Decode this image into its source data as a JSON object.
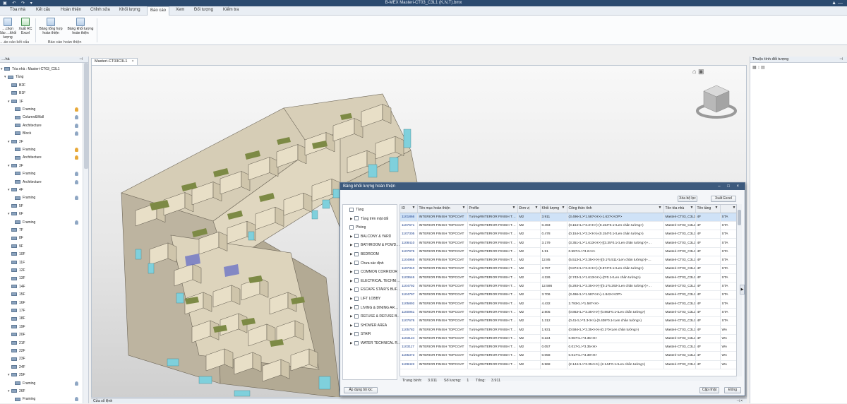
{
  "window": {
    "title": "B-MEX Masteri-CT03_C3L1 (K,N,T).bmx",
    "controls": "▲ —"
  },
  "ribbon": {
    "tabs": [
      "Tòa nhà",
      "Kết cấu",
      "Hoàn thiện",
      "Chỉnh sửa",
      "Khối lượng",
      "Báo cáo",
      "Xem",
      "Đối tượng",
      "Kiểm tra"
    ],
    "active_tab": "Báo cáo",
    "buttons": [
      {
        "label": "…chọn Báo …khối lượng",
        "icon": "report-grid-icon"
      },
      {
        "label": "Xuất RC Excel",
        "icon": "excel-export-icon"
      },
      {
        "label": "Bảng tổng hợp hoàn thiện",
        "icon": "summary-table-icon"
      },
      {
        "label": "Bảng khối lượng hoàn thiện",
        "icon": "quantity-table-icon"
      }
    ],
    "groups": [
      "…áo cáo kết cấu",
      "Báo cáo hoàn thiện"
    ]
  },
  "left_panel": {
    "title": "…hà",
    "pin": "⊣",
    "tree": [
      {
        "label": "Tòa nhà : Masteri-CT03_C3L1",
        "level": 0,
        "expander": "▾"
      },
      {
        "label": "Tầng",
        "level": 1,
        "expander": "▾"
      },
      {
        "label": "B2F",
        "level": 2,
        "expander": ""
      },
      {
        "label": "B1F",
        "level": 2,
        "expander": ""
      },
      {
        "label": "1F",
        "level": 2,
        "expander": "▾"
      },
      {
        "label": "Framing",
        "level": 3,
        "bulb": "on"
      },
      {
        "label": "Column&Wall",
        "level": 3,
        "bulb": "off"
      },
      {
        "label": "Architecture",
        "level": 3,
        "bulb": "off"
      },
      {
        "label": "Block",
        "level": 3,
        "bulb": "off"
      },
      {
        "label": "2F",
        "level": 2,
        "expander": "▾"
      },
      {
        "label": "Framing",
        "level": 3,
        "bulb": "on"
      },
      {
        "label": "Architecture",
        "level": 3,
        "bulb": "on"
      },
      {
        "label": "3F",
        "level": 2,
        "expander": "▾"
      },
      {
        "label": "Framing",
        "level": 3,
        "bulb": "off"
      },
      {
        "label": "Architecture",
        "level": 3,
        "bulb": "off"
      },
      {
        "label": "4F",
        "level": 2,
        "expander": "▾"
      },
      {
        "label": "Framing",
        "level": 3,
        "bulb": "off"
      },
      {
        "label": "5F",
        "level": 2,
        "expander": ""
      },
      {
        "label": "6F",
        "level": 2,
        "expander": "▾"
      },
      {
        "label": "Framing",
        "level": 3,
        "bulb": "off"
      },
      {
        "label": "7F",
        "level": 2,
        "expander": ""
      },
      {
        "label": "8F",
        "level": 2,
        "expander": ""
      },
      {
        "label": "9F",
        "level": 2,
        "expander": ""
      },
      {
        "label": "10F",
        "level": 2,
        "expander": ""
      },
      {
        "label": "11F",
        "level": 2,
        "expander": ""
      },
      {
        "label": "12F",
        "level": 2,
        "expander": ""
      },
      {
        "label": "13F",
        "level": 2,
        "expander": ""
      },
      {
        "label": "14F",
        "level": 2,
        "expander": ""
      },
      {
        "label": "15F",
        "level": 2,
        "expander": ""
      },
      {
        "label": "16F",
        "level": 2,
        "expander": ""
      },
      {
        "label": "17F",
        "level": 2,
        "expander": ""
      },
      {
        "label": "18F",
        "level": 2,
        "expander": ""
      },
      {
        "label": "19F",
        "level": 2,
        "expander": ""
      },
      {
        "label": "20F",
        "level": 2,
        "expander": ""
      },
      {
        "label": "21F",
        "level": 2,
        "expander": ""
      },
      {
        "label": "22F",
        "level": 2,
        "expander": ""
      },
      {
        "label": "23F",
        "level": 2,
        "expander": ""
      },
      {
        "label": "24F",
        "level": 2,
        "expander": ""
      },
      {
        "label": "25F",
        "level": 2,
        "expander": "▾"
      },
      {
        "label": "Framing",
        "level": 3,
        "bulb": "off"
      },
      {
        "label": "26F",
        "level": 2,
        "expander": "▾"
      },
      {
        "label": "Framing",
        "level": 3,
        "bulb": "off"
      }
    ]
  },
  "document_tab": {
    "label": "Masteri-CT03C3L1",
    "close": "×"
  },
  "right_panel": {
    "title": "Thuộc tính đối tượng",
    "pin": "⊣"
  },
  "bottom_panel": {
    "title": "Cửa sổ lệnh",
    "pin": "⊣ ×"
  },
  "dialog": {
    "title": "Bảng khối lượng hoàn thiện",
    "window_controls": "– □ ×",
    "clear_filter": "Xóa bộ lọc",
    "export_excel": "Xuất Excel",
    "apply_filter": "Áp dụng bộ lọc",
    "update": "Cập nhật",
    "close": "Đóng",
    "filter_tree": [
      {
        "label": "Tầng",
        "arrow": "",
        "indent": 0
      },
      {
        "label": "Tầng trên mặt đất",
        "arrow": "▶",
        "indent": 1
      },
      {
        "label": "Phòng",
        "arrow": "",
        "indent": 0
      },
      {
        "label": "BALCONY & YARD",
        "arrow": "▶",
        "indent": 1
      },
      {
        "label": "BATHROOM & POWD…",
        "arrow": "▶",
        "indent": 1
      },
      {
        "label": "BEDROOM",
        "arrow": "▶",
        "indent": 1
      },
      {
        "label": "Chưa xác định",
        "arrow": "▶",
        "indent": 1
      },
      {
        "label": "COMMON CORRIDOR",
        "arrow": "▶",
        "indent": 1
      },
      {
        "label": "ELECTRICAL TECHNI…",
        "arrow": "▶",
        "indent": 1
      },
      {
        "label": "ESCAPE STAIR'S BUF…",
        "arrow": "▶",
        "indent": 1
      },
      {
        "label": "LIFT LOBBY",
        "arrow": "▶",
        "indent": 1
      },
      {
        "label": "LIVING & DINING AR…",
        "arrow": "▶",
        "indent": 1
      },
      {
        "label": "REFUSE & REFUSE B…",
        "arrow": "▶",
        "indent": 1
      },
      {
        "label": "SHOWER AREA",
        "arrow": "▶",
        "indent": 1
      },
      {
        "label": "STAIR",
        "arrow": "▶",
        "indent": 1
      },
      {
        "label": "WATER TECHNICAL R…",
        "arrow": "▶",
        "indent": 1
      }
    ],
    "columns": [
      "ID",
      "Tên mục hoàn thiện",
      "Profile",
      "Đơn vị",
      "Khối lượng",
      "Công thức tính",
      "Tên tòa nhà",
      "Tên tầng",
      ""
    ],
    "rows": [
      [
        "1101866",
        "INTERIOR FINISH TOPCOAT",
        "Tường#INTERIOR FINISH T…",
        "M2",
        "3.911",
        "(3.496<L>*1.587<H>)-1.637<AOP>",
        "Masteri-CT03_C3L1",
        "4F",
        "STA"
      ],
      [
        "1107671",
        "INTERIOR FINISH TOPCOAT",
        "Tường#INTERIOR FINISH T…",
        "M2",
        "0.493",
        "(0.154<L>*3.3<H>)-(0.154*0.1<Len chân tường>)",
        "Masteri-CT03_C3L1",
        "4F",
        "STA"
      ],
      [
        "1107305",
        "INTERIOR FINISH TOPCOAT",
        "Tường#INTERIOR FINISH T…",
        "M2",
        "0.478",
        "(0.154<L>*3.2<H>)-(0.154*0.1<Len chân tường>)",
        "Masteri-CT03_C3L1",
        "4F",
        "STA"
      ],
      [
        "1108410",
        "INTERIOR FINISH TOPCOAT",
        "Tường#INTERIOR FINISH T…",
        "M2",
        "3.179",
        "(3.351<L>*1.613<H>)-[(3.35*0.1<Len chân tường>)+…",
        "Masteri-CT03_C3L1",
        "4F",
        "STA"
      ],
      [
        "1107976",
        "INTERIOR FINISH TOPCOAT",
        "Tường#INTERIOR FINISH T…",
        "M2",
        "1.91",
        "0.597<L>*3.2<H>",
        "Masteri-CT03_C3L1",
        "4F",
        "STA"
      ],
      [
        "1104965",
        "INTERIOR FINISH TOPCOAT",
        "Tường#INTERIOR FINISH T…",
        "M2",
        "12.85",
        "(5.513<L>*3.35<H>)-[(0.1*5.511<Len chân tường>)+…",
        "Masteri-CT03_C3L1",
        "4F",
        "STA"
      ],
      [
        "1107310",
        "INTERIOR FINISH TOPCOAT",
        "Tường#INTERIOR FINISH T…",
        "M2",
        "2.797",
        "(0.874<L>*3.3<H>)-(0.874*0.1<Len chân tường>)",
        "Masteri-CT03_C3L1",
        "4F",
        "STA"
      ],
      [
        "1103646",
        "INTERIOR FINISH TOPCOAT",
        "Tường#INTERIOR FINISH T…",
        "M2",
        "4.226",
        "(2.743<L>*1.613<H>)-(0*0.1<Len chân tường>)",
        "Masteri-CT03_C3L1",
        "4F",
        "STA"
      ],
      [
        "1104792",
        "INTERIOR FINISH TOPCOAT",
        "Tường#INTERIOR FINISH T…",
        "M2",
        "12.586",
        "(5.293<L>*3.35<H>)-[(0.1*5.292<Len chân tường>)+…",
        "Masteri-CT03_C3L1",
        "4F",
        "STA"
      ],
      [
        "1104797",
        "INTERIOR FINISH TOPCOAT",
        "Tường#INTERIOR FINISH T…",
        "M2",
        "3.706",
        "(3.496<L>*1.587<H>)-1.842<AOP>",
        "Masteri-CT03_C3L1",
        "4F",
        "STA"
      ],
      [
        "1105892",
        "INTERIOR FINISH TOPCOAT",
        "Tường#INTERIOR FINISH T…",
        "M2",
        "4.432",
        "2.793<L>*1.587<H>",
        "Masteri-CT03_C3L1",
        "4F",
        "STA"
      ],
      [
        "1100961",
        "INTERIOR FINISH TOPCOAT",
        "Tường#INTERIOR FINISH T…",
        "M2",
        "2.805",
        "(0.863<L>*3.35<H>)-(0.863*0.1<Len chân tường>)",
        "Masteri-CT03_C3L1",
        "4F",
        "STA"
      ],
      [
        "1107676",
        "INTERIOR FINISH TOPCOAT",
        "Tường#INTERIOR FINISH T…",
        "M2",
        "1.312",
        "(0.41<L>*3.3<H>)-(0.408*0.1<Len chân tường>)",
        "Masteri-CT03_C3L1",
        "4F",
        "STA"
      ],
      [
        "1105782",
        "INTERIOR FINISH TOPCOAT",
        "Tường#INTERIOR FINISH T…",
        "M2",
        "1.931",
        "(0.594<L>*3.35<H>)-(0.1*0<Len chân tường>)",
        "Masteri-CT03_C3L1",
        "4F",
        "WA"
      ],
      [
        "1103124",
        "INTERIOR FINISH TOPCOAT",
        "Tường#INTERIOR FINISH T…",
        "M2",
        "0.224",
        "0.067<L>*3.35<H>",
        "Masteri-CT03_C3L1",
        "4F",
        "WA"
      ],
      [
        "1103117",
        "INTERIOR FINISH TOPCOAT",
        "Tường#INTERIOR FINISH T…",
        "M2",
        "0.057",
        "0.017<L>*3.35<H>",
        "Masteri-CT03_C3L1",
        "4F",
        "WA"
      ],
      [
        "1105373",
        "INTERIOR FINISH TOPCOAT",
        "Tường#INTERIOR FINISH T…",
        "M2",
        "0.058",
        "0.017<L>*3.39<H>",
        "Masteri-CT03_C3L1",
        "4F",
        "WA"
      ],
      [
        "1108422",
        "INTERIOR FINISH TOPCOAT",
        "Tường#INTERIOR FINISH T…",
        "M2",
        "6.968",
        "(2.144<L>*3.35<H>)-(2.144*0.1<Len chân tường>)",
        "Masteri-CT03_C3L1",
        "4F",
        "WA"
      ]
    ],
    "summary": {
      "avg_label": "Trung bình:",
      "avg_value": "3.911",
      "count_label": "Số lượng:",
      "count_value": "1",
      "sum_label": "Tổng:",
      "sum_value": "3.911"
    }
  },
  "colors": {
    "accent": "#2b4a6f",
    "selection": "#cfe2f7",
    "wall": "#e6dcc3",
    "glass": "#7fd0dc",
    "floor": "#7d8a45"
  }
}
